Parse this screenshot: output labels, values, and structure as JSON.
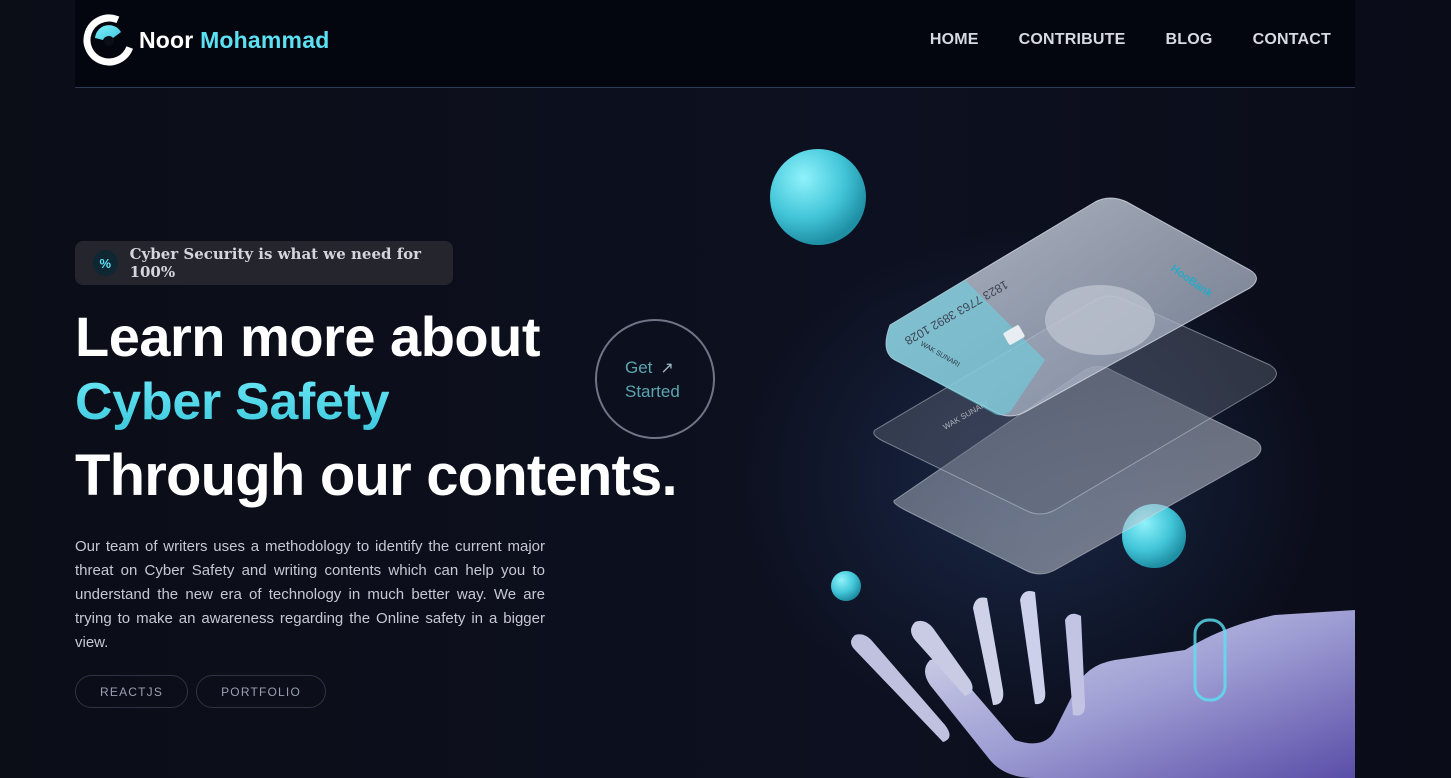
{
  "brand": {
    "first_name": "Noor",
    "last_name": "Mohammad",
    "icon": "logo-c-icon",
    "accent_color": "#5ce1f2"
  },
  "nav": {
    "items": [
      {
        "label": "HOME"
      },
      {
        "label": "CONTRIBUTE"
      },
      {
        "label": "BLOG"
      },
      {
        "label": "CONTACT"
      }
    ]
  },
  "hero": {
    "badge": {
      "icon": "percent-icon",
      "text": "Cyber Security is what we need for 100%"
    },
    "heading_line1": "Learn more about",
    "heading_line2": "Cyber Safety",
    "heading_line3": "Through our contents.",
    "cta": {
      "line1": "Get",
      "line2": "Started",
      "icon": "arrow-up-right-icon"
    },
    "description": "Our team of writers uses a methodology to identify the current major threat on Cyber Safety and writing contents which can help you to understand the new era of technology in much better way. We are trying to make an awareness regarding the Online safety in a bigger view.",
    "tags": [
      {
        "label": "REACTJS"
      },
      {
        "label": "PORTFOLIO"
      }
    ]
  },
  "illustration": {
    "card_brand": "HooBank",
    "card_number": "1823 7763 3892 1028",
    "card_holder": "WAK SUNARI",
    "card_expiry": "06/2024"
  }
}
